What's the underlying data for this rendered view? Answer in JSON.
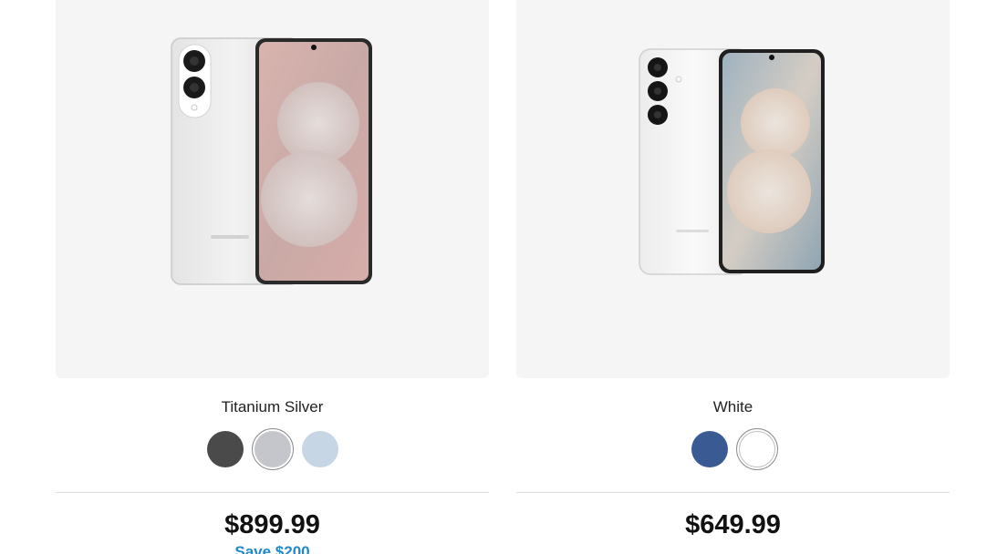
{
  "products": [
    {
      "image_alt": "phone-image",
      "selected_color": "Titanium Silver",
      "swatches": [
        {
          "color": "#4a4a4a",
          "selected": false
        },
        {
          "color": "#c4c6cc",
          "selected": true
        },
        {
          "color": "#c7d6e4",
          "selected": false
        }
      ],
      "price": "$899.99",
      "save": "Save $200"
    },
    {
      "image_alt": "phone-image",
      "selected_color": "White",
      "swatches": [
        {
          "color": "#3a5a93",
          "selected": false
        },
        {
          "color": "#ffffff",
          "selected": true
        }
      ],
      "price": "$649.99",
      "save": ""
    }
  ],
  "colors": {
    "image_bg": "#f5f5f5",
    "divider": "#dcdcdc",
    "save_text": "#2189ca"
  }
}
